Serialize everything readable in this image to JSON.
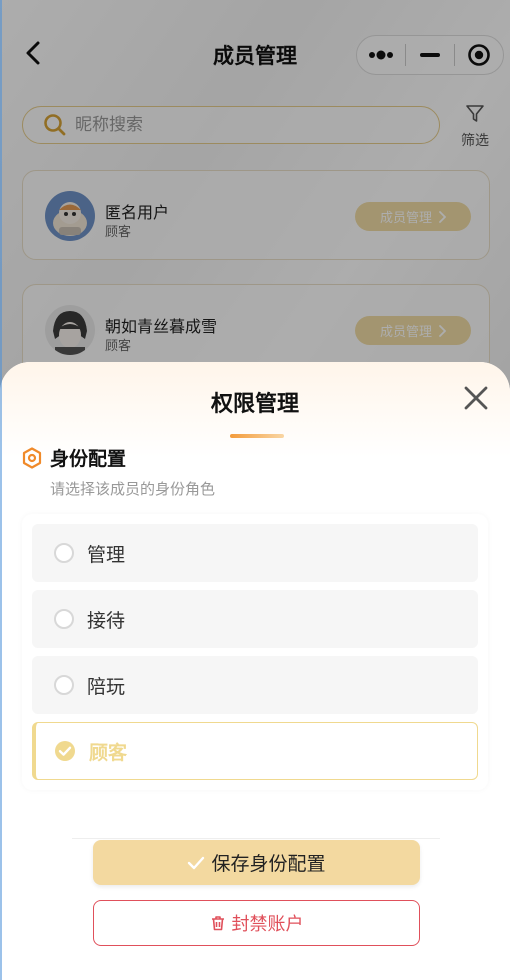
{
  "nav": {
    "title": "成员管理"
  },
  "search": {
    "placeholder": "昵称搜索"
  },
  "filter": {
    "label": "筛选"
  },
  "members": [
    {
      "name": "匿名用户",
      "role": "顾客",
      "action": "成员管理"
    },
    {
      "name": "朝如青丝暮成雪",
      "role": "顾客",
      "action": "成员管理"
    }
  ],
  "sheet": {
    "title": "权限管理",
    "section_title": "身份配置",
    "section_desc": "请选择该成员的身份角色",
    "options": [
      {
        "label": "管理",
        "selected": false
      },
      {
        "label": "接待",
        "selected": false
      },
      {
        "label": "陪玩",
        "selected": false
      },
      {
        "label": "顾客",
        "selected": true
      }
    ],
    "save_label": "保存身份配置",
    "ban_label": "封禁账户"
  },
  "colors": {
    "accent": "#f0d98f",
    "save_bg": "#f3d9a0",
    "danger": "#e0505b",
    "icon_orange": "#f08a2a"
  },
  "icons": {
    "back": "back-icon",
    "more": "more-icon",
    "minimize": "minimize-icon",
    "target": "target-icon",
    "search": "search-icon",
    "filter": "filter-icon",
    "chevron": "chevron-right-icon",
    "close": "close-icon",
    "hexagon": "hexagon-icon",
    "check": "check-icon",
    "trash": "trash-icon"
  }
}
